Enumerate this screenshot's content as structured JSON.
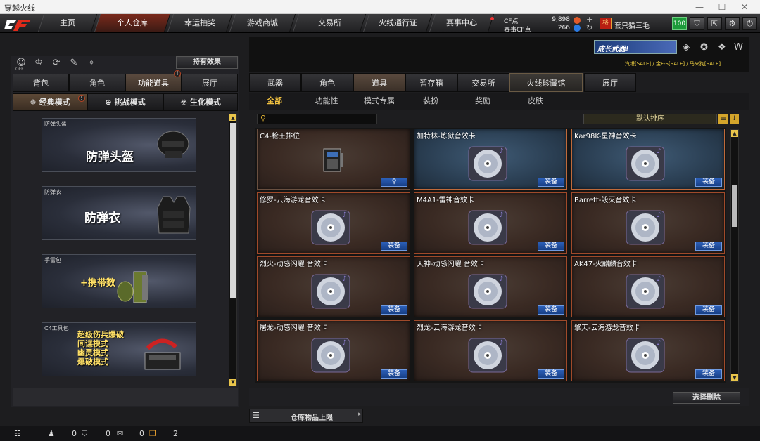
{
  "window": {
    "title": "穿越火线"
  },
  "nav": {
    "tabs": [
      "主页",
      "个人仓库",
      "幸运抽奖",
      "游戏商城",
      "交易所",
      "火线通行证",
      "赛事中心"
    ],
    "active": "个人仓库"
  },
  "currency": {
    "cf_label": "CF点",
    "cf_value": "9,898",
    "event_label": "赛事CF点",
    "event_value": "266"
  },
  "user": {
    "name": "套只猫三毛",
    "level": "100",
    "rank_glyph": "将"
  },
  "left": {
    "effect_button": "持有效果",
    "off_label": "OFF",
    "tabs": [
      "背包",
      "角色",
      "功能道具",
      "展厅"
    ],
    "active_tab": "功能道具",
    "modes": [
      "经典模式",
      "挑战模式",
      "生化模式"
    ],
    "active_mode": "经典模式",
    "items": [
      {
        "caption": "防弹头盔",
        "title": "防弹头盔"
      },
      {
        "caption": "防弹衣",
        "title": "防弹衣"
      },
      {
        "caption": "手雷包",
        "title": "+携带数"
      },
      {
        "caption": "C4工具包",
        "lines": [
          "超级伤兵爆破",
          "间谍模式",
          "幽灵模式",
          "爆破模式"
        ]
      }
    ]
  },
  "right": {
    "banner": {
      "title": "成长武器!",
      "ticker": "汽锤[SALE] / 金F-S[SALE] / 马来狗[SALE]"
    },
    "tabs": [
      "武器",
      "角色",
      "道具",
      "暂存箱",
      "交易所",
      "火线珍藏馆",
      "展厅"
    ],
    "active_tab": "道具",
    "subtabs": [
      "全部",
      "功能性",
      "模式专属",
      "装扮",
      "奖励",
      "皮肤"
    ],
    "active_subtab": "全部",
    "sort_label": "默认排序",
    "equip_label": "装备",
    "cards": [
      {
        "name": "C4-枪王排位",
        "kind": "c4"
      },
      {
        "name": "加特林-炼狱音效卡",
        "kind": "blue"
      },
      {
        "name": "Kar98K-星神音效卡",
        "kind": "blue"
      },
      {
        "name": "修罗-云海游龙音效卡",
        "kind": "disc"
      },
      {
        "name": "M4A1-雷神音效卡",
        "kind": "disc"
      },
      {
        "name": "Barrett-毁灭音效卡",
        "kind": "disc"
      },
      {
        "name": "烈火-动感闪耀 音效卡",
        "kind": "disc"
      },
      {
        "name": "天神-动感闪耀 音效卡",
        "kind": "disc"
      },
      {
        "name": "AK47-火麒麟音效卡",
        "kind": "disc"
      },
      {
        "name": "屠龙-动感闪耀 音效卡",
        "kind": "disc"
      },
      {
        "name": "烈龙-云海游龙音效卡",
        "kind": "disc"
      },
      {
        "name": "擎天-云海游龙音效卡",
        "kind": "disc"
      }
    ],
    "select_delete": "选择删除",
    "capacity": "仓库物品上限"
  },
  "status": {
    "a": "0",
    "b": "0",
    "c": "0",
    "d": "2"
  }
}
